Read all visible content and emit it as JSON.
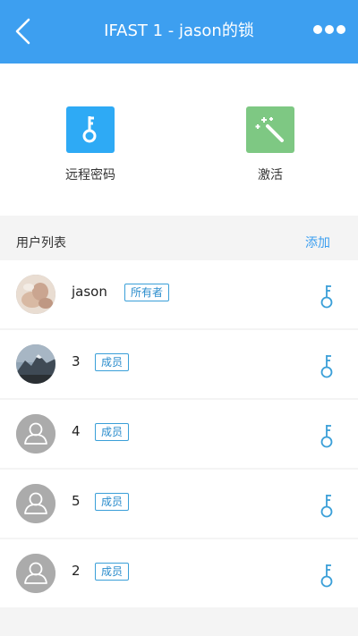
{
  "header": {
    "title": "IFAST 1 - jason的锁",
    "back_icon": "chevron-left-icon",
    "more_icon": "more-dots-icon",
    "bg_color": "#3d9ff0"
  },
  "actions": [
    {
      "label": "远程密码",
      "icon": "key-icon",
      "color": "#2eaaf5"
    },
    {
      "label": "激活",
      "icon": "magic-wand-icon",
      "color": "#7ec883"
    }
  ],
  "user_section": {
    "title": "用户列表",
    "add_label": "添加"
  },
  "users": [
    {
      "name": "jason",
      "role": "所有者",
      "avatar": "photo-hands"
    },
    {
      "name": "3",
      "role": "成员",
      "avatar": "photo-mountain"
    },
    {
      "name": "4",
      "role": "成员",
      "avatar": "default-user-icon"
    },
    {
      "name": "5",
      "role": "成员",
      "avatar": "default-user-icon"
    },
    {
      "name": "2",
      "role": "成员",
      "avatar": "default-user-icon"
    }
  ],
  "accent_color": "#3a9fd8"
}
